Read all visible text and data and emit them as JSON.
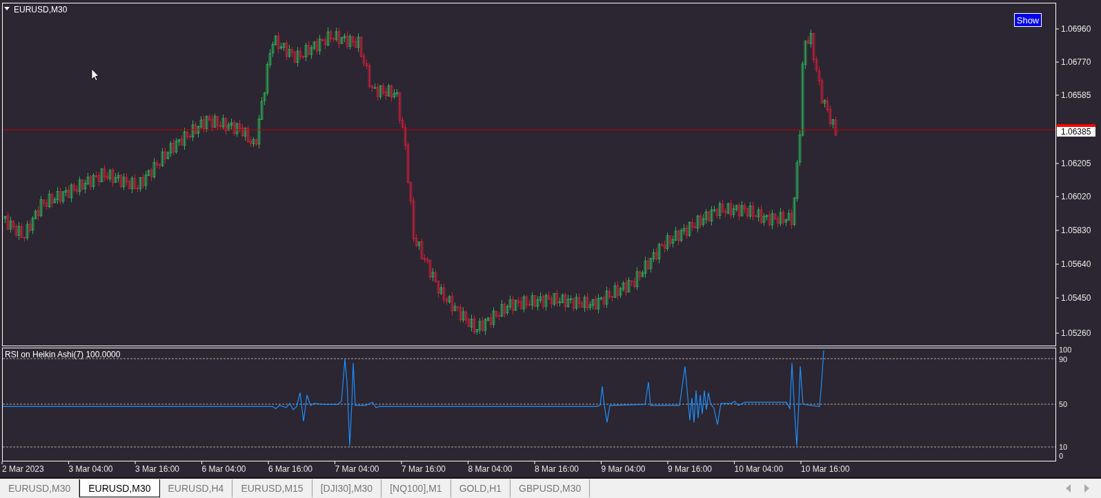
{
  "chart": {
    "title": "EURUSD,M30",
    "show_button": "Show",
    "price_axis": [
      "1.06960",
      "1.06770",
      "1.06585",
      "1.06205",
      "1.06020",
      "1.05830",
      "1.05640",
      "1.05450",
      "1.05260"
    ],
    "current_price": "1.06385",
    "time_axis": [
      "2 Mar 2023",
      "3 Mar 04:00",
      "3 Mar 16:00",
      "6 Mar 04:00",
      "6 Mar 16:00",
      "7 Mar 04:00",
      "7 Mar 16:00",
      "8 Mar 04:00",
      "8 Mar 16:00",
      "9 Mar 04:00",
      "9 Mar 16:00",
      "10 Mar 04:00",
      "10 Mar 16:00"
    ]
  },
  "indicator": {
    "title": "RSI on Heikin Ashi(7) 100.0000",
    "levels": [
      "100",
      "90",
      "50",
      "10",
      "0"
    ]
  },
  "tabs": [
    {
      "label": "EURUSD,M30",
      "selected": false
    },
    {
      "label": "EURUSD,M30",
      "selected": true
    },
    {
      "label": "EURUSD,H4",
      "selected": false
    },
    {
      "label": "EURUSD,M15",
      "selected": false
    },
    {
      "label": "[DJI30],M30",
      "selected": false
    },
    {
      "label": "[NQ100],M1",
      "selected": false
    },
    {
      "label": "GOLD,H1",
      "selected": false
    },
    {
      "label": "GBPUSD,M30",
      "selected": false
    }
  ]
}
